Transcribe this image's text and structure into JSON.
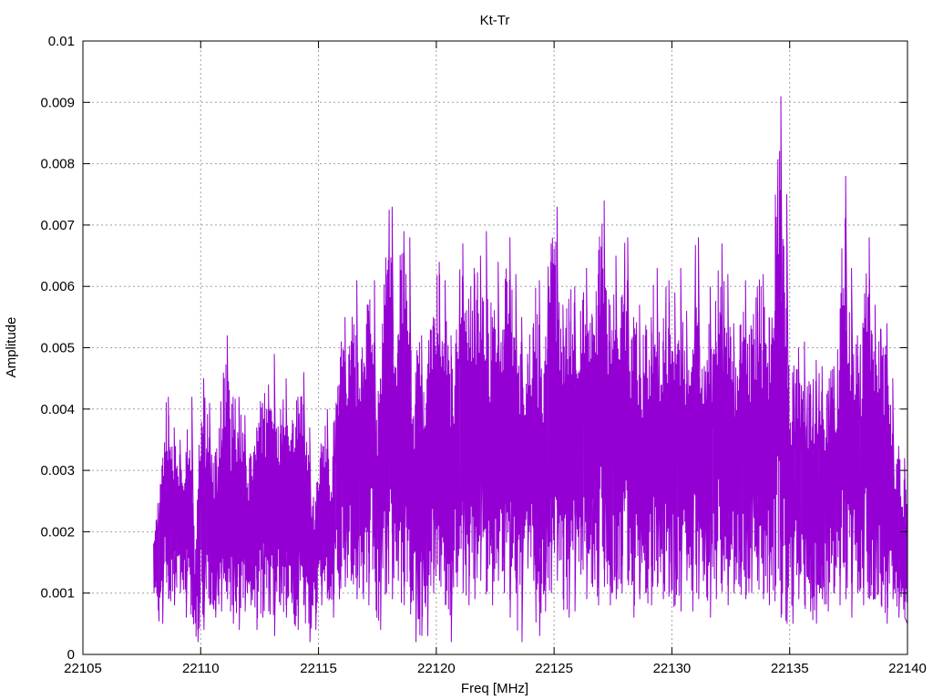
{
  "chart_data": {
    "type": "line",
    "title": "Kt-Tr",
    "xlabel": "Freq [MHz]",
    "ylabel": "Amplitude",
    "xlim": [
      22105,
      22140
    ],
    "ylim": [
      0,
      0.01
    ],
    "x_ticks": [
      22105,
      22110,
      22115,
      22120,
      22125,
      22130,
      22135,
      22140
    ],
    "x_tick_labels": [
      "22105",
      "22110",
      "22115",
      "22120",
      "22125",
      "22130",
      "22135",
      "22140"
    ],
    "y_ticks": [
      0,
      0.001,
      0.002,
      0.003,
      0.004,
      0.005,
      0.006,
      0.007,
      0.008,
      0.009,
      0.01
    ],
    "y_tick_labels": [
      "0",
      "0.001",
      "0.002",
      "0.003",
      "0.004",
      "0.005",
      "0.006",
      "0.007",
      "0.008",
      "0.009",
      "0.01"
    ],
    "grid": true,
    "grid_style": "dotted",
    "legend": "none",
    "series": [
      {
        "color": "#9400D3",
        "x": [
          22108.0,
          22108.25,
          22108.5,
          22108.75,
          22109.0,
          22109.25,
          22109.5,
          22109.75,
          22110.0,
          22110.25,
          22110.5,
          22110.75,
          22111.0,
          22111.25,
          22111.5,
          22111.75,
          22112.0,
          22112.25,
          22112.5,
          22112.75,
          22113.0,
          22113.25,
          22113.5,
          22113.75,
          22114.0,
          22114.25,
          22114.5,
          22114.75,
          22115.0,
          22115.25,
          22115.5,
          22115.75,
          22116.0,
          22116.25,
          22116.5,
          22116.75,
          22117.0,
          22117.25,
          22117.5,
          22117.75,
          22118.0,
          22118.25,
          22118.5,
          22118.75,
          22119.0,
          22119.25,
          22119.5,
          22119.75,
          22120.0,
          22120.25,
          22120.5,
          22120.75,
          22121.0,
          22121.25,
          22121.5,
          22121.75,
          22122.0,
          22122.25,
          22122.5,
          22122.75,
          22123.0,
          22123.25,
          22123.5,
          22123.75,
          22124.0,
          22124.25,
          22124.5,
          22124.75,
          22125.0,
          22125.25,
          22125.5,
          22125.75,
          22126.0,
          22126.25,
          22126.5,
          22126.75,
          22127.0,
          22127.25,
          22127.5,
          22127.75,
          22128.0,
          22128.25,
          22128.5,
          22128.75,
          22129.0,
          22129.25,
          22129.5,
          22129.75,
          22130.0,
          22130.25,
          22130.5,
          22130.75,
          22131.0,
          22131.25,
          22131.5,
          22131.75,
          22132.0,
          22132.25,
          22132.5,
          22132.75,
          22133.0,
          22133.25,
          22133.5,
          22133.75,
          22134.0,
          22134.25,
          22134.5,
          22134.75,
          22135.0,
          22135.25,
          22135.5,
          22135.75,
          22136.0,
          22136.25,
          22136.5,
          22136.75,
          22137.0,
          22137.25,
          22137.5,
          22137.75,
          22138.0,
          22138.25,
          22138.5,
          22138.75,
          22139.0,
          22139.25,
          22139.5,
          22139.75,
          22140.0
        ],
        "y_max": [
          0.0022,
          0.0026,
          0.0042,
          0.0037,
          0.0035,
          0.0033,
          0.0042,
          0.0018,
          0.0045,
          0.0041,
          0.0033,
          0.0035,
          0.0052,
          0.0042,
          0.0042,
          0.0039,
          0.0032,
          0.0037,
          0.0041,
          0.0044,
          0.0049,
          0.0036,
          0.0045,
          0.0036,
          0.0042,
          0.0046,
          0.0037,
          0.0025,
          0.0033,
          0.004,
          0.003,
          0.0044,
          0.0055,
          0.0048,
          0.0061,
          0.0046,
          0.0056,
          0.0061,
          0.0045,
          0.0062,
          0.0073,
          0.0052,
          0.0069,
          0.0068,
          0.0046,
          0.0052,
          0.0045,
          0.0055,
          0.0064,
          0.0061,
          0.0052,
          0.0047,
          0.0067,
          0.0058,
          0.0062,
          0.0065,
          0.0069,
          0.0055,
          0.0064,
          0.0053,
          0.0068,
          0.0062,
          0.0055,
          0.0049,
          0.0054,
          0.0061,
          0.0047,
          0.0067,
          0.0073,
          0.0057,
          0.0058,
          0.006,
          0.0056,
          0.0063,
          0.0055,
          0.0062,
          0.0074,
          0.0057,
          0.0065,
          0.0051,
          0.0068,
          0.0055,
          0.0057,
          0.0052,
          0.0055,
          0.0063,
          0.0051,
          0.0061,
          0.0059,
          0.0063,
          0.0056,
          0.0045,
          0.0068,
          0.0047,
          0.006,
          0.0051,
          0.0067,
          0.0062,
          0.0054,
          0.0048,
          0.0061,
          0.0053,
          0.006,
          0.0062,
          0.0055,
          0.0056,
          0.0091,
          0.0075,
          0.0046,
          0.005,
          0.0051,
          0.0044,
          0.0048,
          0.0047,
          0.0043,
          0.0047,
          0.0046,
          0.0078,
          0.0063,
          0.0052,
          0.0051,
          0.0068,
          0.0057,
          0.0053,
          0.0054,
          0.0045,
          0.0034,
          0.0032,
          0.0026,
          0.0022,
          0.001
        ],
        "y_min": [
          0.001,
          0.0005,
          0.0009,
          0.0008,
          0.001,
          0.0006,
          0.0008,
          0.0002,
          0.0004,
          0.0008,
          0.0006,
          0.0007,
          0.0009,
          0.0005,
          0.0004,
          0.0007,
          0.0008,
          0.0004,
          0.0006,
          0.0007,
          0.0003,
          0.0008,
          0.0006,
          0.0009,
          0.0004,
          0.0008,
          0.0002,
          0.0004,
          0.0008,
          0.001,
          0.0006,
          0.0009,
          0.0011,
          0.0012,
          0.0009,
          0.001,
          0.0008,
          0.0014,
          0.0004,
          0.001,
          0.0009,
          0.0012,
          0.0008,
          0.0011,
          0.0002,
          0.0003,
          0.0003,
          0.001,
          0.0012,
          0.0008,
          0.0002,
          0.0011,
          0.001,
          0.0008,
          0.0009,
          0.0012,
          0.0011,
          0.0008,
          0.0012,
          0.001,
          0.0006,
          0.001,
          0.0002,
          0.0014,
          0.0012,
          0.0003,
          0.0007,
          0.001,
          0.0012,
          0.0009,
          0.0006,
          0.0007,
          0.0013,
          0.0009,
          0.0011,
          0.0008,
          0.0011,
          0.0008,
          0.0009,
          0.001,
          0.0012,
          0.0006,
          0.0009,
          0.001,
          0.0008,
          0.0011,
          0.0009,
          0.001,
          0.0008,
          0.0007,
          0.0012,
          0.0007,
          0.0009,
          0.0013,
          0.0006,
          0.0009,
          0.0012,
          0.0008,
          0.001,
          0.0011,
          0.0009,
          0.001,
          0.0012,
          0.0009,
          0.0008,
          0.0011,
          0.0006,
          0.0005,
          0.0005,
          0.0009,
          0.0008,
          0.0007,
          0.0005,
          0.0009,
          0.0007,
          0.001,
          0.0008,
          0.0009,
          0.0006,
          0.001,
          0.0008,
          0.0009,
          0.0009,
          0.0008,
          0.0005,
          0.0009,
          0.0006,
          0.0006,
          0.0005,
          0.0004,
          0.0001
        ]
      }
    ]
  }
}
